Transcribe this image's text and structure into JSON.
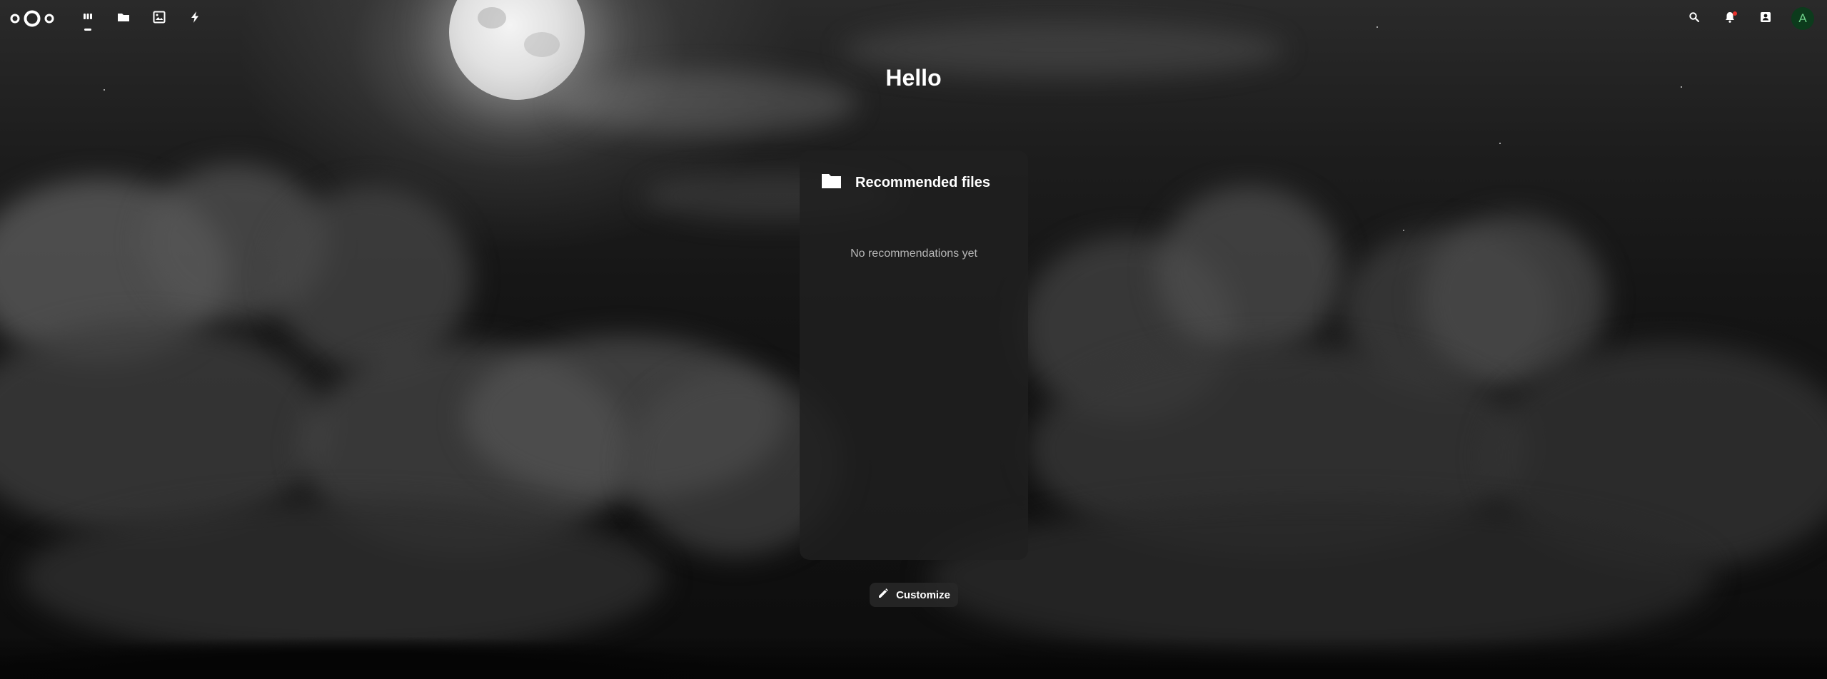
{
  "header": {
    "apps": [
      {
        "name": "Dashboard",
        "icon": "dashboard-icon",
        "active": true
      },
      {
        "name": "Files",
        "icon": "folder-icon",
        "active": false
      },
      {
        "name": "Photos",
        "icon": "image-icon",
        "active": false
      },
      {
        "name": "Activity",
        "icon": "lightning-icon",
        "active": false
      }
    ],
    "right_icons": [
      "search-icon",
      "bell-icon",
      "contacts-icon"
    ],
    "avatar_initial": "A"
  },
  "greeting": "Hello",
  "recommended": {
    "title": "Recommended files",
    "empty_text": "No recommendations yet"
  },
  "customize_label": "Customize",
  "colors": {
    "avatar_bg": "#0c3b1c",
    "avatar_fg": "#6ed28a",
    "notification_badge": "#e9322d"
  }
}
